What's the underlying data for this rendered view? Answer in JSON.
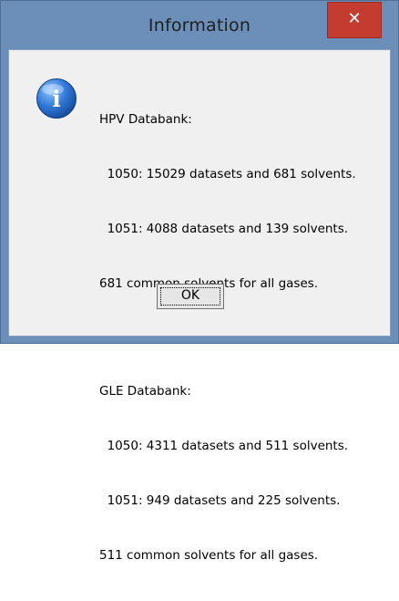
{
  "window": {
    "title": "Information",
    "close_glyph": "✕"
  },
  "message": {
    "lines": [
      "HPV Databank:",
      "  1050: 15029 datasets and 681 solvents.",
      "  1051: 4088 datasets and 139 solvents.",
      "681 common solvents for all gases.",
      "GLE Databank:",
      "  1050: 4311 datasets and 511 solvents.",
      "  1051: 949 datasets and 225 solvents.",
      "511 common solvents for all gases."
    ]
  },
  "icon": {
    "name": "information-icon",
    "glyph": "i",
    "color": "#1f5fb8"
  },
  "buttons": {
    "ok_label": "OK"
  },
  "colors": {
    "titlebar": "#6b8fb8",
    "close_button": "#c43b2f",
    "client_background": "#f0f0f0"
  }
}
